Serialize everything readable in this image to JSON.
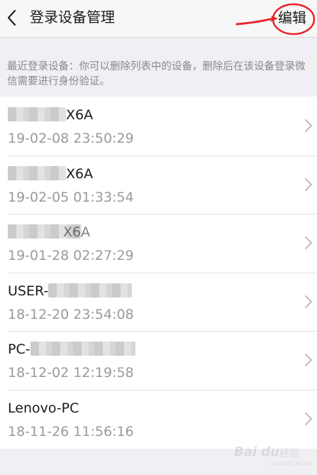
{
  "header": {
    "title": "登录设备管理",
    "edit_label": "编辑",
    "back_icon": "chevron-left-icon"
  },
  "hint": "最近登录设备：你可以删除列表中的设备，删除后在该设备登录微信需要进行身份验证。",
  "devices": [
    {
      "name": "X6A",
      "time": "19-02-08 23:50:29"
    },
    {
      "name": "X6A",
      "time": "19-02-05 01:33:54"
    },
    {
      "name": "X6A",
      "time": "19-01-28 02:27:29"
    },
    {
      "name": "USER-",
      "time": "18-12-20 23:54:08"
    },
    {
      "name": "PC-",
      "time": "18-12-02 12:19:58"
    },
    {
      "name": "Lenovo-PC",
      "time": "18-11-26 11:56:16"
    }
  ],
  "watermark": {
    "brand": "Bai du",
    "label": "经验",
    "url": "jingyan.baidu.com"
  },
  "colors": {
    "annotation_red": "#e8252b",
    "background": "#efeff4",
    "list_background": "#ffffff",
    "secondary_text": "#9a9a9a"
  }
}
